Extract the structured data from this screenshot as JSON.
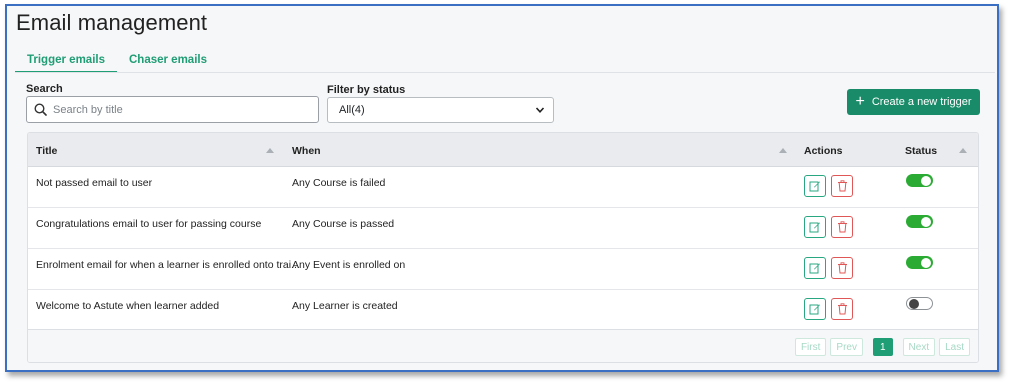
{
  "page": {
    "title": "Email management"
  },
  "tabs": [
    {
      "label": "Trigger emails",
      "active": true
    },
    {
      "label": "Chaser emails",
      "active": false
    }
  ],
  "search": {
    "label": "Search",
    "placeholder": "Search by title",
    "value": ""
  },
  "filter": {
    "label": "Filter by status",
    "selected": "All(4)"
  },
  "create_button": {
    "label": "Create a new trigger"
  },
  "table": {
    "columns": [
      "Title",
      "When",
      "Actions",
      "Status"
    ],
    "rows": [
      {
        "title": "Not passed email to user",
        "when": "Any Course is failed",
        "status": "on"
      },
      {
        "title": "Congratulations email to user for passing course",
        "when": "Any Course is passed",
        "status": "on"
      },
      {
        "title": "Enrolment email for when a learner is enrolled onto trai...",
        "when": "Any Event is enrolled on",
        "status": "on"
      },
      {
        "title": "Welcome to Astute when learner added",
        "when": "Any Learner is created",
        "status": "off"
      }
    ]
  },
  "pagination": {
    "first": "First",
    "prev": "Prev",
    "current": "1",
    "next": "Next",
    "last": "Last"
  },
  "colors": {
    "accent": "#1f9d74",
    "button": "#198b68",
    "toggle_on": "#2bab34",
    "delete": "#e05757",
    "frame_border": "#3a6fc4"
  },
  "icons": [
    "search-icon",
    "chevron-down-icon",
    "plus-icon",
    "edit-icon",
    "trash-icon",
    "sort-icon"
  ]
}
